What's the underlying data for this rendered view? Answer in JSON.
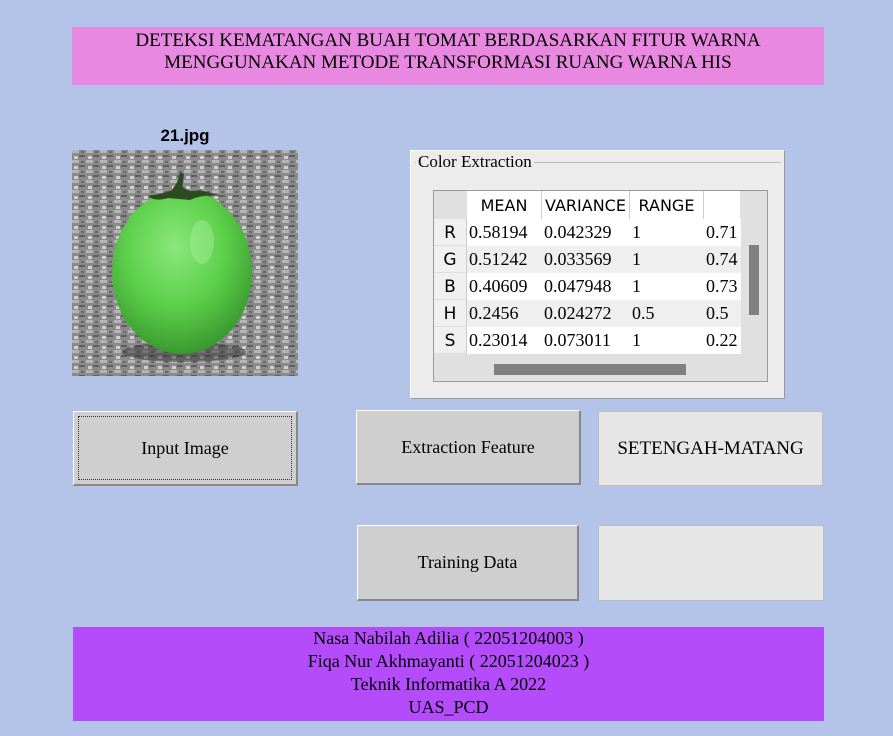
{
  "title": {
    "line1": "DETEKSI KEMATANGAN BUAH TOMAT BERDASARKAN FITUR WARNA",
    "line2": "MENGGUNAKAN METODE TRANSFORMASI RUANG WARNA HIS"
  },
  "image": {
    "filename": "21.jpg"
  },
  "color_extraction": {
    "title": "Color Extraction",
    "columns": [
      "MEAN",
      "VARIANCE",
      "RANGE",
      ""
    ],
    "rows": [
      {
        "label": "R",
        "values": [
          "0.58194",
          "0.042329",
          "1",
          "0.71"
        ]
      },
      {
        "label": "G",
        "values": [
          "0.51242",
          "0.033569",
          "1",
          "0.74"
        ]
      },
      {
        "label": "B",
        "values": [
          "0.40609",
          "0.047948",
          "1",
          "0.73"
        ]
      },
      {
        "label": "H",
        "values": [
          "0.2456",
          "0.024272",
          "0.5",
          "0.5"
        ]
      },
      {
        "label": "S",
        "values": [
          "0.23014",
          "0.073011",
          "1",
          "0.22"
        ]
      }
    ]
  },
  "buttons": {
    "input_image": "Input Image",
    "extraction_feature": "Extraction Feature",
    "training_data": "Training Data"
  },
  "result": {
    "label": "SETENGAH-MATANG",
    "secondary": ""
  },
  "footer": {
    "line1": "Nasa Nabilah Adilia ( 22051204003 )",
    "line2": "Fiqa Nur Akhmayanti ( 22051204023 )",
    "line3": "Teknik Informatika A 2022",
    "line4": "UAS_PCD"
  },
  "colors": {
    "background": "#b4c4e8",
    "title_banner": "#e888e0",
    "footer_banner": "#b44cfc",
    "tomato": "#5ccf4a"
  }
}
